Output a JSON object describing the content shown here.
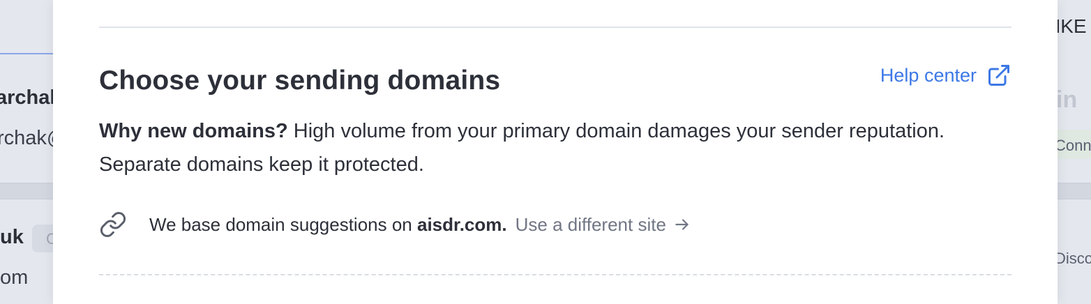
{
  "background": {
    "left": {
      "name_fragment": "archak",
      "email_fragment": "rchak@",
      "second_name_fragment": "uk",
      "chip_fragment": "C",
      "second_email_fragment": "om"
    },
    "right": {
      "header_fragment": "NKE",
      "status_fragment": "Conn",
      "action_fragment": "Disco"
    }
  },
  "modal": {
    "title": "Choose your sending domains",
    "help_link": "Help center",
    "description": {
      "lead": "Why new domains?",
      "body": " High volume from your primary domain damages your sender reputation. Separate domains keep it protected."
    },
    "suggestion": {
      "prefix": "We base domain suggestions on ",
      "domain": "aisdr.com.",
      "change_link": "Use a different site"
    }
  },
  "icons": {
    "help": "external-link-icon",
    "suggestion": "link-icon",
    "change": "arrow-right-icon"
  },
  "colors": {
    "accent": "#3d78e6",
    "text": "#2d3039",
    "muted": "#707684"
  }
}
